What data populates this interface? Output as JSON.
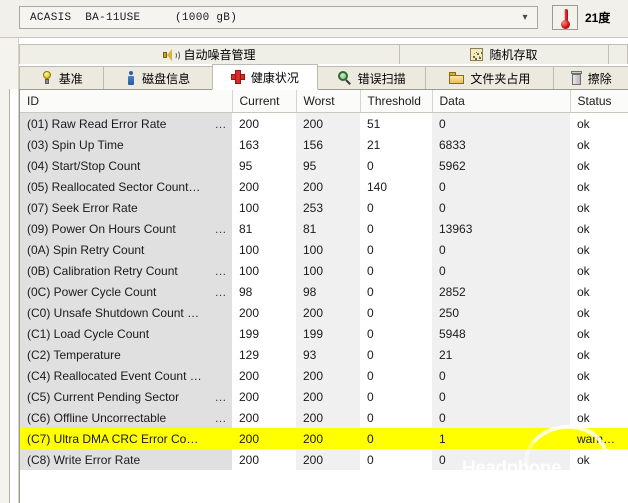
{
  "topbar": {
    "device_model": "ACASIS",
    "device_id": "BA-11USE",
    "device_capacity": "(1000 gB)",
    "dropdown_icon": "chevron-down-icon",
    "temperature": "21度",
    "thermometer_icon": "thermometer-icon"
  },
  "upper_tabs": [
    {
      "label": "自动噪音管理",
      "icon": "speaker-icon"
    },
    {
      "label": "随机存取",
      "icon": "random-access-icon"
    }
  ],
  "lower_tabs": [
    {
      "label": "基准",
      "icon": "lightbulb-icon",
      "active": false
    },
    {
      "label": "磁盘信息",
      "icon": "info-icon",
      "active": false
    },
    {
      "label": "健康状况",
      "icon": "red-cross-icon",
      "active": true
    },
    {
      "label": "错误扫描",
      "icon": "magnifier-icon",
      "active": false
    },
    {
      "label": "文件夹占用",
      "icon": "folder-icon",
      "active": false
    },
    {
      "label": "擦除",
      "icon": "trash-icon",
      "active": false
    }
  ],
  "table": {
    "columns": [
      "ID",
      "Current",
      "Worst",
      "Threshold",
      "Data",
      "Status"
    ],
    "rows": [
      {
        "id": "(01) Raw Read Error Rate",
        "truncated": true,
        "current": "200",
        "worst": "200",
        "threshold": "51",
        "data": "0",
        "status": "ok",
        "highlight": false
      },
      {
        "id": "(03) Spin Up Time",
        "truncated": false,
        "current": "163",
        "worst": "156",
        "threshold": "21",
        "data": "6833",
        "status": "ok",
        "highlight": false
      },
      {
        "id": "(04) Start/Stop Count",
        "truncated": false,
        "current": "95",
        "worst": "95",
        "threshold": "0",
        "data": "5962",
        "status": "ok",
        "highlight": false
      },
      {
        "id": "(05) Reallocated Sector Count…",
        "truncated": false,
        "current": "200",
        "worst": "200",
        "threshold": "140",
        "data": "0",
        "status": "ok",
        "highlight": false
      },
      {
        "id": "(07) Seek Error Rate",
        "truncated": false,
        "current": "100",
        "worst": "253",
        "threshold": "0",
        "data": "0",
        "status": "ok",
        "highlight": false
      },
      {
        "id": "(09) Power On Hours Count",
        "truncated": true,
        "current": "81",
        "worst": "81",
        "threshold": "0",
        "data": "13963",
        "status": "ok",
        "highlight": false
      },
      {
        "id": "(0A) Spin Retry Count",
        "truncated": false,
        "current": "100",
        "worst": "100",
        "threshold": "0",
        "data": "0",
        "status": "ok",
        "highlight": false
      },
      {
        "id": "(0B) Calibration Retry Count",
        "truncated": true,
        "current": "100",
        "worst": "100",
        "threshold": "0",
        "data": "0",
        "status": "ok",
        "highlight": false
      },
      {
        "id": "(0C) Power Cycle Count",
        "truncated": true,
        "current": "98",
        "worst": "98",
        "threshold": "0",
        "data": "2852",
        "status": "ok",
        "highlight": false
      },
      {
        "id": "(C0) Unsafe Shutdown Count …",
        "truncated": false,
        "current": "200",
        "worst": "200",
        "threshold": "0",
        "data": "250",
        "status": "ok",
        "highlight": false
      },
      {
        "id": "(C1) Load Cycle Count",
        "truncated": false,
        "current": "199",
        "worst": "199",
        "threshold": "0",
        "data": "5948",
        "status": "ok",
        "highlight": false
      },
      {
        "id": "(C2) Temperature",
        "truncated": false,
        "current": "129",
        "worst": "93",
        "threshold": "0",
        "data": "21",
        "status": "ok",
        "highlight": false
      },
      {
        "id": "(C4) Reallocated Event Count …",
        "truncated": false,
        "current": "200",
        "worst": "200",
        "threshold": "0",
        "data": "0",
        "status": "ok",
        "highlight": false
      },
      {
        "id": "(C5) Current Pending Sector",
        "truncated": true,
        "current": "200",
        "worst": "200",
        "threshold": "0",
        "data": "0",
        "status": "ok",
        "highlight": false
      },
      {
        "id": "(C6) Offline Uncorrectable",
        "truncated": true,
        "current": "200",
        "worst": "200",
        "threshold": "0",
        "data": "0",
        "status": "ok",
        "highlight": false
      },
      {
        "id": "(C7) Ultra DMA CRC Error Co…",
        "truncated": false,
        "current": "200",
        "worst": "200",
        "threshold": "0",
        "data": "1",
        "status": "warn…",
        "highlight": true
      },
      {
        "id": "(C8) Write Error Rate",
        "truncated": false,
        "current": "200",
        "worst": "200",
        "threshold": "0",
        "data": "0",
        "status": "ok",
        "highlight": false
      }
    ]
  },
  "watermark": {
    "text": "Headphone"
  },
  "colors": {
    "highlight_row": "#ffff00",
    "accent_red": "#d42b2b",
    "window_chrome": "#f1f0ea"
  }
}
